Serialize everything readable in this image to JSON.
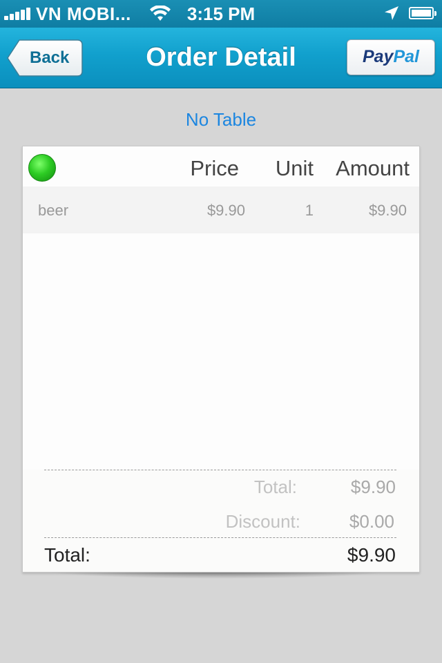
{
  "status_bar": {
    "carrier": "VN MOBI...",
    "time": "3:15 PM",
    "icons": [
      "signal-bars-icon",
      "wifi-icon",
      "location-arrow-icon",
      "battery-icon"
    ]
  },
  "nav": {
    "title": "Order Detail",
    "back_label": "Back",
    "paypal_pay": "Pay",
    "paypal_pal": "Pal"
  },
  "order": {
    "table_label": "No Table",
    "status_color": "#2dcc24",
    "columns": {
      "price": "Price",
      "unit": "Unit",
      "amount": "Amount"
    },
    "items": [
      {
        "name": "beer",
        "price": "$9.90",
        "unit": "1",
        "amount": "$9.90"
      }
    ],
    "summary": {
      "total_label": "Total:",
      "total_value": "$9.90",
      "discount_label": "Discount:",
      "discount_value": "$0.00",
      "grand_total_label": "Total:",
      "grand_total_value": "$9.90"
    }
  },
  "colors": {
    "nav_bar": "#11a0cd",
    "link_blue": "#1c86e0",
    "background": "#d6d6d6"
  }
}
